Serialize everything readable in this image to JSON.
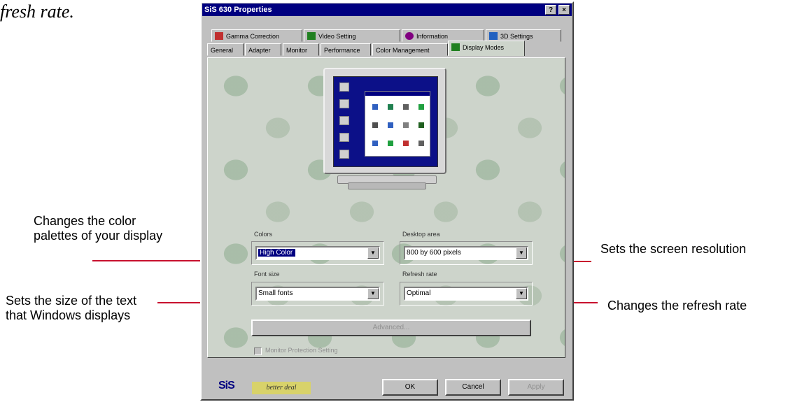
{
  "page_text": {
    "fragment": "fresh rate."
  },
  "dialog": {
    "title": "SiS 630 Properties",
    "title_buttons": {
      "help": "?",
      "close": "×"
    },
    "tabs_row1": [
      {
        "label": "Gamma Correction",
        "icon": "gamma-icon",
        "color": "#c03030"
      },
      {
        "label": "Video Setting",
        "icon": "video-icon",
        "color": "#208020"
      },
      {
        "label": "Information",
        "icon": "info-icon",
        "color": "#800080"
      },
      {
        "label": "3D Settings",
        "icon": "cube-icon",
        "color": "#2060c0"
      }
    ],
    "tabs_row2": [
      {
        "label": "General"
      },
      {
        "label": "Adapter"
      },
      {
        "label": "Monitor"
      },
      {
        "label": "Performance"
      },
      {
        "label": "Color Management"
      },
      {
        "label": "Display Modes",
        "icon": "display-modes-icon",
        "color": "#208020",
        "active": true
      }
    ],
    "colors": {
      "label": "Colors",
      "value": "High Color"
    },
    "desktop_area": {
      "label": "Desktop area",
      "value": "800 by 600 pixels"
    },
    "font_size": {
      "label": "Font size",
      "value": "Small fonts"
    },
    "refresh_rate": {
      "label": "Refresh rate",
      "value": "Optimal"
    },
    "advanced_button": "Advanced...",
    "monitor_protection": "Monitor Protection Setting",
    "ok_button": "OK",
    "cancel_button": "Cancel",
    "apply_button": "Apply",
    "logo_text": "SiS",
    "slogan": "better deal"
  },
  "callouts": {
    "colors": "Changes the color palettes of your display",
    "resolution": "Sets the screen resolution",
    "font_size": "Sets the size of the text that Windows displays",
    "refresh": "Changes the refresh rate"
  },
  "accent_color": "#c8102e",
  "window_title_color": "#000080"
}
